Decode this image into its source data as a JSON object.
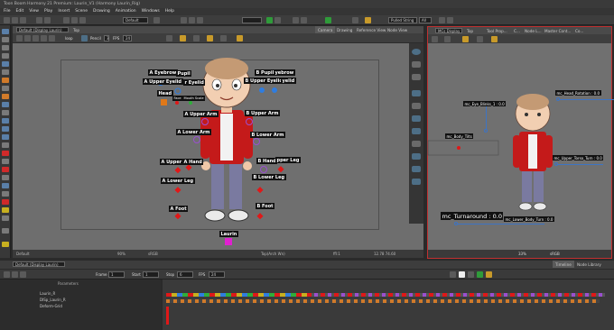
{
  "window": {
    "title": "Toon Boom Harmony 21 Premium: Laurin_V1 (Harmony Laurin_Rig)"
  },
  "menu": [
    "File",
    "Edit",
    "View",
    "Play",
    "Insert",
    "Scene",
    "Drawing",
    "Animation",
    "Windows",
    "Help"
  ],
  "toolbar": {
    "workspace": "Default",
    "pencil_preset": "Pulled String",
    "all_label": "All"
  },
  "camera_view": {
    "view_select": "Default (Display Laurin)",
    "top_label": "Top",
    "tabs": [
      "Camera",
      "Drawing",
      "Reference View",
      "Node View"
    ],
    "loop_label": "loop",
    "pencil_label": "Pencil",
    "pencil_value": "3",
    "fps_label": "FPS",
    "fps_value": "24",
    "status_left": "Default",
    "status_zoom": "90%",
    "status_color": "sRGB",
    "status_display": "Top(Arch Wn)",
    "status_fov": "ffl:1",
    "status_coords": "12.78 74.60"
  },
  "pegs": {
    "a_eyebrow": "A Eyebrow",
    "pupil": "Pupil",
    "a_upper_eyelid": "A Upper Eyelid",
    "r_eyelid": "r Eyelid",
    "b_pupil": "B Pupil",
    "eyebrow": "yebrow",
    "b_upper_eyelid": "B Upper Eyelid",
    "yelid": "yelid",
    "head": "Head",
    "face": "Face",
    "mouth_scale": "Mouth Scale",
    "a_upper_arm": "A Upper Arm",
    "b_upper_arm": "B Upper Arm",
    "a_lower_arm": "A Lower Arm",
    "b_lower_arm": "B Lower Arm",
    "a_upper": "A Upper",
    "a_hand": "A Hand",
    "b_hand": "B Hand",
    "pper_leg": "pper Leg",
    "a_lower_leg": "A Lower Leg",
    "b_lower_leg": "B Lower Leg",
    "a_foot": "A Foot",
    "b_foot": "B Foot",
    "laurin": "Laurin"
  },
  "mc_view": {
    "view_select": "MCs Display",
    "top_label": "Top",
    "tabs": [
      "Tool Prop...",
      "C...",
      "Node L...",
      "Master Cont...",
      "Co..."
    ],
    "controls": {
      "eye_blinks": "mc_Eye_Blinks_1 : 0.0",
      "head_rotation": "mc_Head_Rotation : 0.0",
      "body_tilts": "mc_Body_Tilts",
      "upper_torso_turn": "mc_Upper_Torso_Turn : 0.0",
      "turnaround": "mc_Turnaround : 0.0",
      "lower_body_turn": "mc_Lower_Body_Turn : 0.0"
    },
    "status_zoom": "33%",
    "status_color": "sRGB"
  },
  "timeline": {
    "view_select": "Default (Display Laurin)",
    "tabs": [
      "Timeline",
      "Node Library"
    ],
    "frame_label": "Frame",
    "frame_value": "1",
    "start_label": "Start",
    "start_value": "1",
    "stop_label": "Stop",
    "stop_value": "6",
    "fps_label": "FPS",
    "fps_value": "24",
    "rows": [
      "Laurin_R",
      "DISp_Laurin_R",
      "Deform-Grid"
    ],
    "param_header": "Parameters"
  },
  "colors": {
    "peg_red": "#e01818",
    "peg_purple": "#9b4fd0",
    "peg_blue": "#2f7de0",
    "mc_blue": "#3d74c4",
    "active_border": "#c03030",
    "laurin_magenta": "#e020d0"
  }
}
